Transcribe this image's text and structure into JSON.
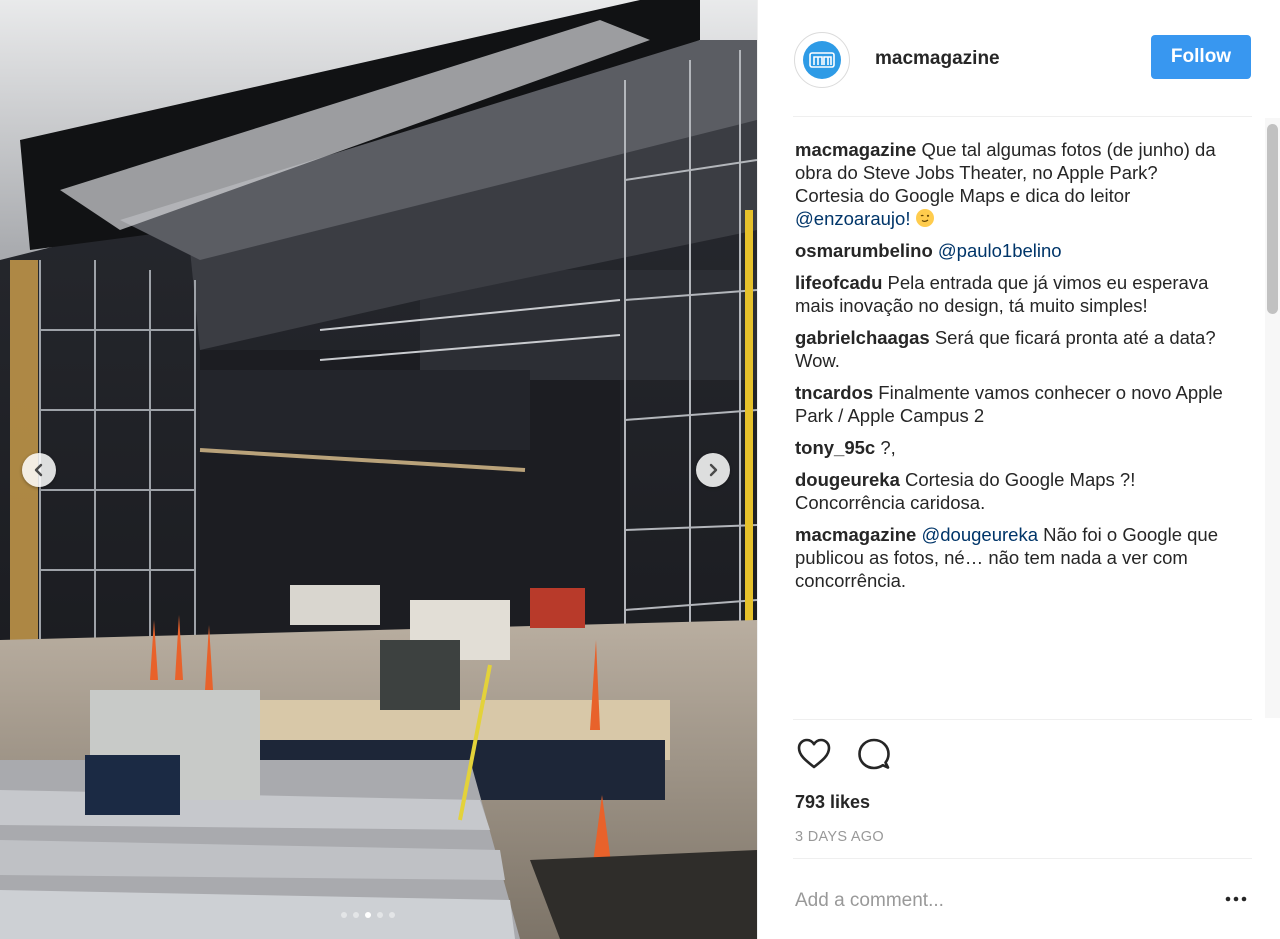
{
  "account": {
    "username": "macmagazine",
    "follow_label": "Follow"
  },
  "comments": [
    {
      "user": "macmagazine",
      "text": "Que tal algumas fotos (de junho) da obra do Steve Jobs Theater, no Apple Park? Cortesia do Google Maps e dica do leitor ",
      "mention": "@enzoaraujo!",
      "emoji": true
    },
    {
      "user": "osmarumbelino",
      "text": "",
      "mention": "@paulo1belino",
      "emoji": false
    },
    {
      "user": "lifeofcadu",
      "text": "Pela entrada que já vimos eu esperava mais inovação no design, tá muito simples!",
      "mention": "",
      "emoji": false
    },
    {
      "user": "gabrielchaagas",
      "text": "Será que ficará pronta até a data? Wow.",
      "mention": "",
      "emoji": false
    },
    {
      "user": "tncardos",
      "text": "Finalmente vamos conhecer o novo Apple Park / Apple Campus 2",
      "mention": "",
      "emoji": false
    },
    {
      "user": "tony_95c",
      "text": "?,",
      "mention": "",
      "emoji": false
    },
    {
      "user": "dougeureka",
      "text": "Cortesia do Google Maps ?! Concorrência caridosa.",
      "mention": "",
      "emoji": false
    },
    {
      "user": "macmagazine",
      "text": " Não foi o Google que publicou as fotos, né… não tem nada a ver com concorrência.",
      "mention": "@dougeureka",
      "mention_first": true,
      "emoji": false
    }
  ],
  "likes": "793 likes",
  "timestamp": "3 DAYS AGO",
  "comment_input": {
    "placeholder": "Add a comment..."
  },
  "carousel": {
    "total": 5,
    "active_index": 2
  },
  "icons": {
    "like": "heart-icon",
    "comment": "comment-bubble-icon",
    "prev": "chevron-left-icon",
    "next": "chevron-right-icon",
    "more": "more-options-icon"
  },
  "colors": {
    "follow_bg": "#3897f0",
    "mention": "#003569",
    "muted": "#999999"
  }
}
